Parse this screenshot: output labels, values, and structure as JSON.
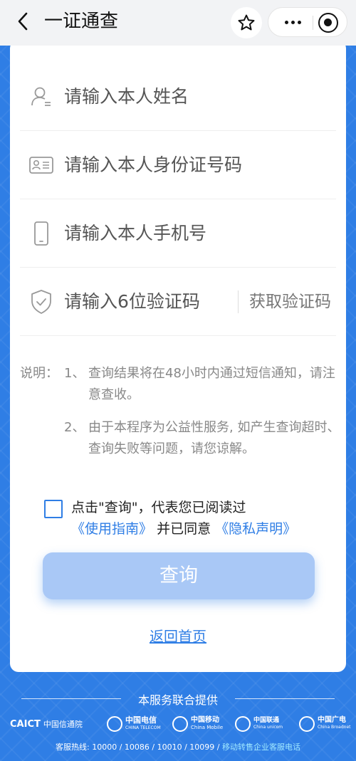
{
  "nav": {
    "title": "一证通查",
    "back_icon": "chevron-left-icon",
    "star_icon": "star-icon",
    "more_icon": "more-dots-icon",
    "close_icon": "target-circle-icon"
  },
  "form": {
    "name_placeholder": "请输入本人姓名",
    "id_placeholder": "请输入本人身份证号码",
    "phone_placeholder": "请输入本人手机号",
    "code_placeholder": "请输入6位验证码",
    "get_code_label": "获取验证码"
  },
  "notes": {
    "lead": "说明：",
    "items": [
      {
        "num": "1、",
        "text": "查询结果将在48小时内通过短信通知，请注意查收。"
      },
      {
        "num": "2、",
        "text": "由于本程序为公益性服务, 如产生查询超时、查询失败等问题，请您谅解。"
      }
    ]
  },
  "agreement": {
    "text1": "点击\"查询\"，代表您已阅读过",
    "link_guide": "《使用指南》",
    "text2": "并已同意",
    "link_privacy": "《隐私声明》"
  },
  "actions": {
    "query_label": "查询",
    "home_link": "返回首页"
  },
  "footer": {
    "title": "本服务联合提供",
    "logos": [
      {
        "big": "CAICT",
        "small": "中国信通院"
      },
      {
        "big": "中国电信",
        "small": "CHINA TELECOM"
      },
      {
        "big": "中国移动",
        "small": "China Mobile"
      },
      {
        "big": "中国联通",
        "small": "China unicom"
      },
      {
        "big": "中国广电",
        "small": "China Broadnet"
      }
    ],
    "hotline_prefix": "客服热线: 10000 / 10086 / 10010 / 10099 /",
    "hotline_link": "移动转售企业客服电话"
  },
  "colors": {
    "accent": "#2f7ee5",
    "button_disabled": "#a9c8f6",
    "background": "#2f7ee5"
  }
}
